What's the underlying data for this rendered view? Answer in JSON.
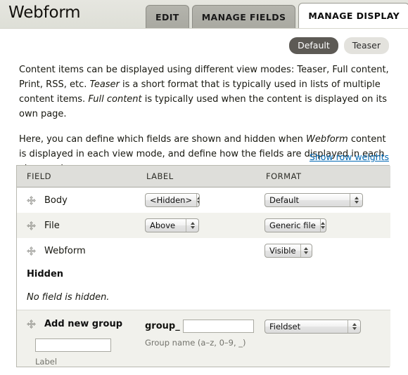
{
  "header": {
    "title": "Webform",
    "primary_tabs": [
      {
        "label": "EDIT",
        "active": false
      },
      {
        "label": "MANAGE FIELDS",
        "active": false
      },
      {
        "label": "MANAGE DISPLAY",
        "active": true
      }
    ]
  },
  "view_modes": {
    "selected": "Default",
    "options": [
      {
        "label": "Default",
        "selected": true
      },
      {
        "label": "Teaser",
        "selected": false
      }
    ]
  },
  "intro": {
    "paragraph1_part1": "Content items can be displayed using different view modes: Teaser, Full content, Print, RSS, etc. ",
    "paragraph1_em1": "Teaser",
    "paragraph1_part2": " is a short format that is typically used in lists of multiple content items. ",
    "paragraph1_em2": "Full content",
    "paragraph1_part3": " is typically used when the content is displayed on its own page.",
    "paragraph2_part1": "Here, you can define which fields are shown and hidden when ",
    "paragraph2_em1": "Webform",
    "paragraph2_part2": " content is displayed in each view mode, and define how the fields are displayed in each view mode."
  },
  "table": {
    "show_row_weights_link": "Show row weights",
    "columns": {
      "field": "FIELD",
      "label": "LABEL",
      "format": "FORMAT"
    },
    "rows": [
      {
        "field": "Body",
        "label_select": "<Hidden>",
        "format_select": "Default"
      },
      {
        "field": "File",
        "label_select": "Above",
        "format_select": "Generic file"
      },
      {
        "field": "Webform",
        "label_select": null,
        "format_select": "Visible"
      }
    ],
    "hidden_section": {
      "title": "Hidden",
      "empty_message": "No field is hidden."
    },
    "add_new_group": {
      "title": "Add new group",
      "label_input_value": "",
      "label_hint": "Label",
      "group_prefix": "group_",
      "group_input_value": "",
      "group_hint": "Group name (a–z, 0–9, _)",
      "format_select": "Fieldset"
    }
  },
  "icons": {
    "drag_handle": "drag-cross-icon"
  },
  "colors": {
    "link": "#0168b3",
    "header_band": "#dedfd7",
    "active_tab": "#ffffff",
    "inactive_tab": "#a9a9a1",
    "pill_selected_bg": "#5d5a55",
    "pill_unselected_bg": "#e3e2dd",
    "table_header_bg": "#dededa",
    "row_alt_bg": "#f2f2ed",
    "addgroup_bg": "#f1f1ec"
  }
}
